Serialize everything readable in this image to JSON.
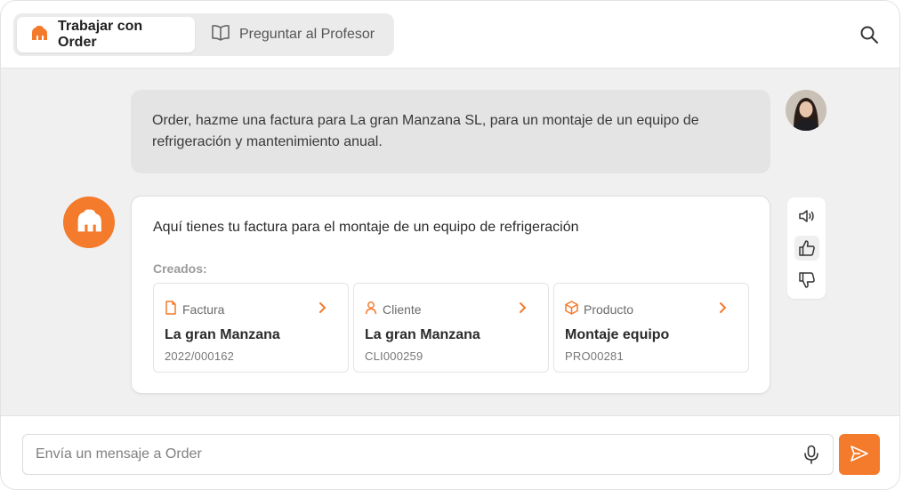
{
  "tabs": [
    {
      "label": "Trabajar con Order",
      "icon": "gorilla-icon",
      "active": true
    },
    {
      "label": "Preguntar al Profesor",
      "icon": "book-icon",
      "active": false
    }
  ],
  "header": {
    "search_icon": "search-icon"
  },
  "chat": {
    "user_message": "Order, hazme una factura para La gran Manzana SL, para un montaje de un equipo de refrigeración y mantenimiento anual.",
    "bot_message": "Aquí tienes tu factura para el montaje de un equipo de refrigeración",
    "created_label": "Creados:",
    "items": [
      {
        "type": "Factura",
        "icon": "document-icon",
        "title": "La gran Manzana",
        "code": "2022/000162"
      },
      {
        "type": "Cliente",
        "icon": "user-icon",
        "title": "La gran Manzana",
        "code": "CLI000259"
      },
      {
        "type": "Producto",
        "icon": "box-icon",
        "title": "Montaje equipo",
        "code": "PRO00281"
      }
    ]
  },
  "actions": [
    "speaker-icon",
    "thumbs-up-icon",
    "thumbs-down-icon"
  ],
  "composer": {
    "placeholder": "Envía un mensaje a Order"
  },
  "colors": {
    "accent": "#f47a2c",
    "background": "#f0f0f0",
    "user_bubble": "#e4e4e4"
  }
}
